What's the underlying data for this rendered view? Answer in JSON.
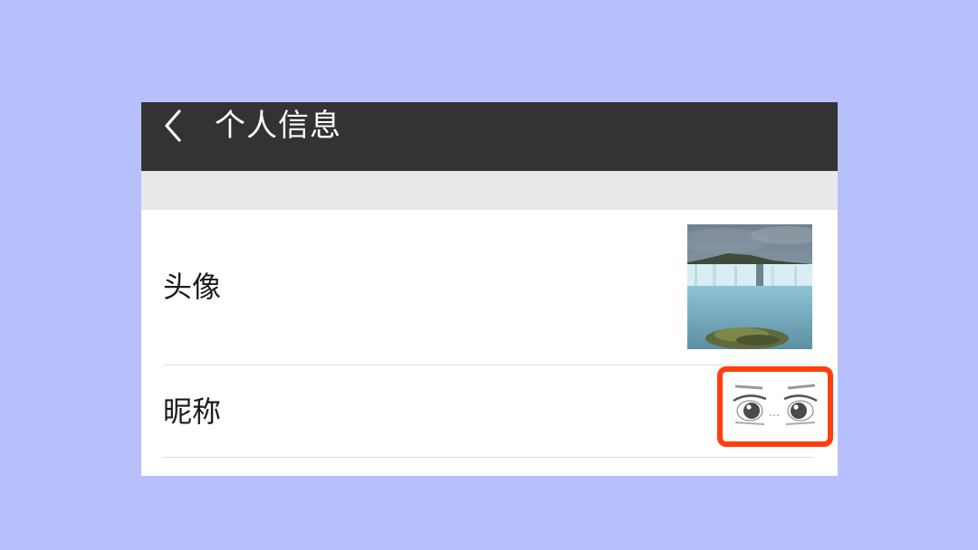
{
  "page": {
    "background": "#b7c0fd"
  },
  "header": {
    "title": "个人信息",
    "back_icon": "chevron-left-icon",
    "background": "#333333"
  },
  "profile": {
    "avatar_label": "头像",
    "avatar_image": "waterfall-landscape-photo",
    "nickname_label": "昵称",
    "nickname_image": "anime-eyes-sticker",
    "highlight_color": "#ff3e0e"
  }
}
